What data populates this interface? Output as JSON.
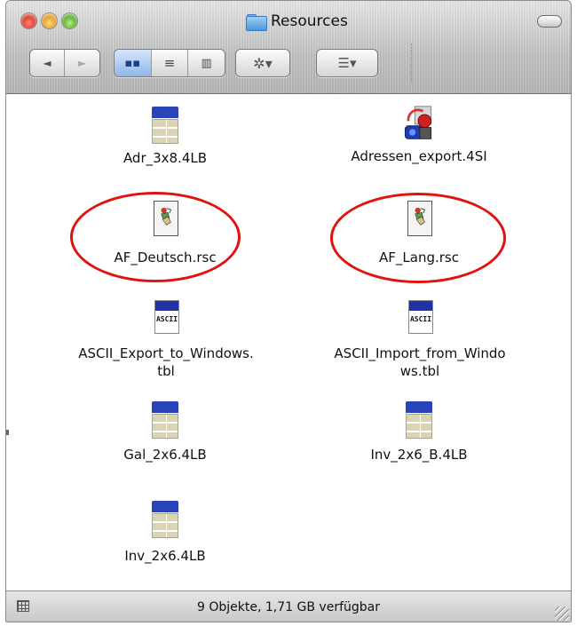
{
  "window": {
    "title": "Resources"
  },
  "toolbar": {
    "back_label": "◄",
    "forward_label": "►",
    "view_icon": "icon-view-icon",
    "view_list": "list-view-icon",
    "view_columns": "column-view-icon",
    "action_label": "✲▾",
    "arrange_label": "☰▾"
  },
  "files": [
    {
      "name": "Adr_3x8.4LB",
      "icon": "spreadsheet-doc-icon"
    },
    {
      "name": "Adressen_export.4SI",
      "icon": "export-app-icon"
    },
    {
      "name": "AF_Deutsch.rsc",
      "icon": "resource-doc-icon",
      "highlighted": true
    },
    {
      "name": "AF_Lang.rsc",
      "icon": "resource-doc-icon",
      "highlighted": true
    },
    {
      "name": "ASCII_Export_to_Windows.",
      "name2": "tbl",
      "icon": "ascii-doc-icon",
      "icon_text": "ASCII"
    },
    {
      "name": "ASCII_Import_from_Windo",
      "name2": "ws.tbl",
      "icon": "ascii-doc-icon",
      "icon_text": "ASCII"
    },
    {
      "name": "Gal_2x6.4LB",
      "icon": "spreadsheet-doc-icon"
    },
    {
      "name": "Inv_2x6_B.4LB",
      "icon": "spreadsheet-doc-icon"
    },
    {
      "name": "Inv_2x6.4LB",
      "icon": "spreadsheet-doc-icon"
    }
  ],
  "status": {
    "text": "9 Objekte, 1,71 GB verfügbar"
  },
  "colors": {
    "highlight_oval": "#e0140e",
    "close": "#d41f10",
    "minimize": "#d98a00",
    "zoom": "#3d9c12"
  }
}
